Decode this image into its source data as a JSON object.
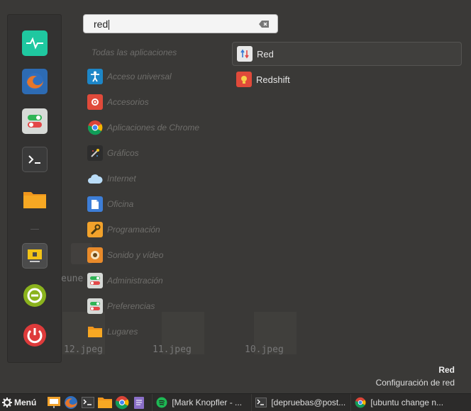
{
  "desktop": {
    "files": [
      "12.jpeg",
      "11.jpeg",
      "10.jpeg"
    ],
    "partial_label": "eune"
  },
  "sidebar": {
    "favorites": [
      {
        "name": "system-monitor-icon",
        "color": "#1fc8a0"
      },
      {
        "name": "firefox-icon",
        "color": "#e6762b"
      },
      {
        "name": "settings-toggle-icon",
        "color": "#cfd2cf"
      },
      {
        "name": "terminal-icon",
        "color": "#3d3d3d"
      },
      {
        "name": "folder-icon",
        "color": "#f7a823"
      }
    ],
    "session": [
      {
        "name": "lock-screen-icon",
        "color": "#4b4b4b"
      },
      {
        "name": "logout-icon",
        "color": "#8bb31d"
      },
      {
        "name": "power-icon",
        "color": "#de3b3b"
      }
    ]
  },
  "search": {
    "value": "red"
  },
  "categories": {
    "title": "Todas las aplicaciones",
    "items": [
      {
        "label": "Acceso universal",
        "icon": "accessibility-icon",
        "color": "#1d86c7"
      },
      {
        "label": "Accesorios",
        "icon": "accessories-icon",
        "color": "#e04a3a"
      },
      {
        "label": "Aplicaciones de Chrome",
        "icon": "chrome-icon",
        "color": "#2f9f45"
      },
      {
        "label": "Gráficos",
        "icon": "graphics-icon",
        "color": "#2d2d2d"
      },
      {
        "label": "Internet",
        "icon": "cloud-icon",
        "color": "#6bb0e8"
      },
      {
        "label": "Oficina",
        "icon": "office-icon",
        "color": "#3d7ed7"
      },
      {
        "label": "Programación",
        "icon": "wrench-icon",
        "color": "#f2a22b"
      },
      {
        "label": "Sonido y vídeo",
        "icon": "speaker-icon",
        "color": "#e88a2a"
      },
      {
        "label": "Administración",
        "icon": "admin-toggle-icon",
        "color": "#cfd2cf"
      },
      {
        "label": "Preferencias",
        "icon": "preferences-toggle-icon",
        "color": "#cfd2cf"
      },
      {
        "label": "Lugares",
        "icon": "places-folder-icon",
        "color": "#f7a823"
      }
    ]
  },
  "results": [
    {
      "label": "Red",
      "icon": "network-icon",
      "selected": true
    },
    {
      "label": "Redshift",
      "icon": "redshift-icon",
      "selected": false
    }
  ],
  "info": {
    "title": "Red",
    "description": "Configuración de red"
  },
  "taskbar": {
    "menu_label": "Menú",
    "launchers": [
      "presentation-icon",
      "firefox-icon",
      "terminal-icon",
      "folder-icon",
      "chrome-icon",
      "text-editor-icon"
    ],
    "tasks": [
      {
        "label": "[Mark Knopfler - ...",
        "icon": "spotify-icon"
      },
      {
        "label": "[depruebas@post...",
        "icon": "terminal-icon"
      },
      {
        "label": "[ubuntu change n...",
        "icon": "chrome-icon"
      }
    ]
  }
}
